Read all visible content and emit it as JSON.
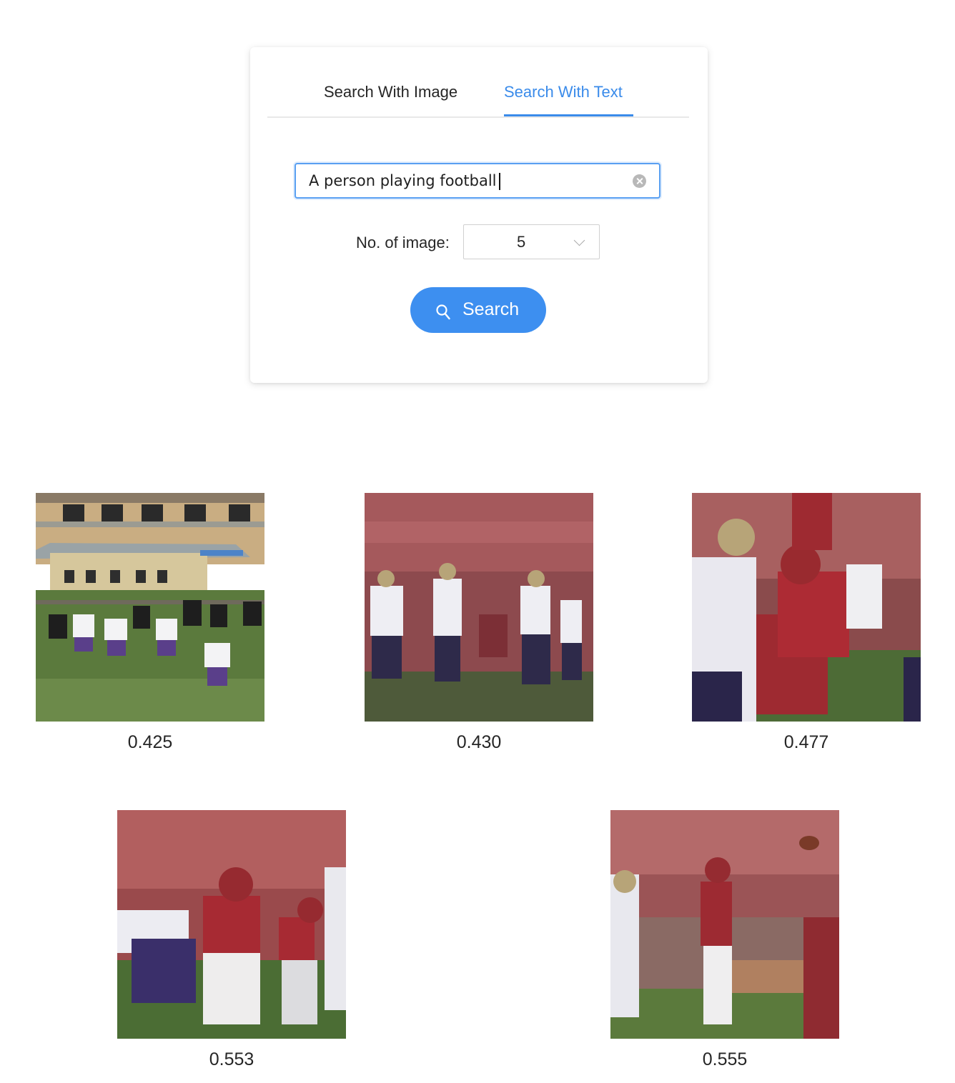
{
  "tabs": [
    {
      "label": "Search With Image",
      "active": false
    },
    {
      "label": "Search With Text",
      "active": true
    }
  ],
  "search": {
    "value": "A person playing football",
    "placeholder": ""
  },
  "count": {
    "label": "No. of image:",
    "value": "5"
  },
  "button": {
    "label": "Search"
  },
  "results": [
    {
      "score": "0.425",
      "image": "football-players-lined-up-in-front-of-building"
    },
    {
      "score": "0.430",
      "image": "football-players-white-jerseys-stadium-crowd"
    },
    {
      "score": "0.477",
      "image": "football-linemen-red-and-white-jerseys"
    },
    {
      "score": "0.553",
      "image": "football-lineman-sooners-50"
    },
    {
      "score": "0.555",
      "image": "quarterback-red-jersey-throwing-ball"
    }
  ],
  "colors": {
    "accent": "#3a8bea",
    "button": "#3d8ff0",
    "inactive_tab": "#262626",
    "divider": "#e8e8e8"
  }
}
